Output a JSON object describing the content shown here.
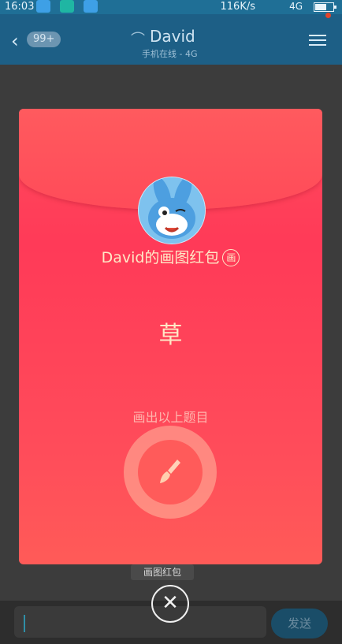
{
  "status_bar": {
    "time": "16:03",
    "speed": "116K/s",
    "network": "4G"
  },
  "header": {
    "unread": "99+",
    "contact_name": "David",
    "contact_status": "手机在线 - 4G"
  },
  "packet": {
    "title": "David的画图红包",
    "title_tag": "画",
    "topic": "草",
    "hint": "画出以上题目"
  },
  "chat": {
    "caption": "画图红包",
    "send_label": "发送"
  },
  "icons": [
    "weather-app-icon",
    "screenshot-app-icon",
    "back-icon",
    "ear-icon",
    "menu-icon",
    "brush-icon",
    "close-icon"
  ]
}
